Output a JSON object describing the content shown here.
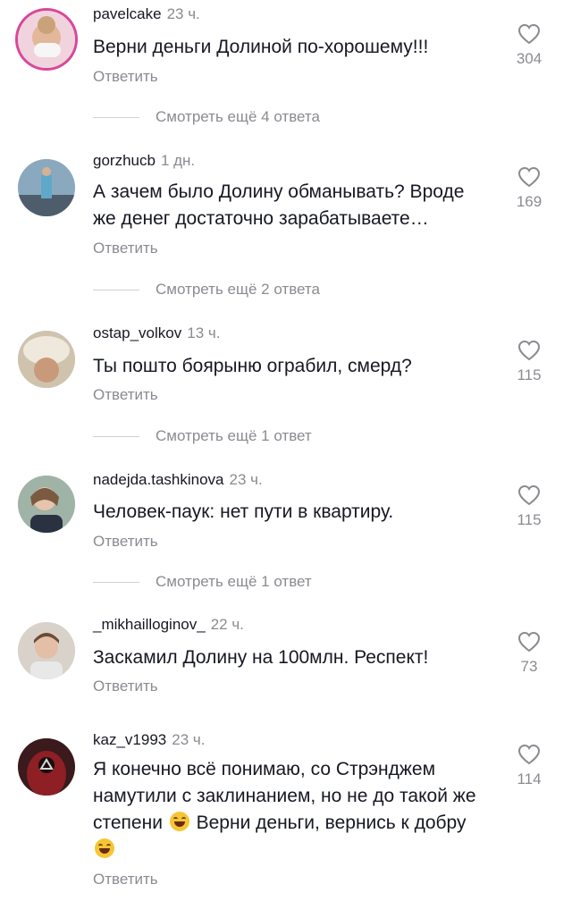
{
  "comments": [
    {
      "username": "pavelcake",
      "time": "23 ч.",
      "text": "Верни деньги Долиной по-хорошему!!!",
      "reply": "Ответить",
      "likes": "304",
      "avatar_color": "#e9b8c8",
      "avatar_ring": "#d9479a"
    },
    {
      "username": "gorzhucb",
      "time": "1 дн.",
      "text": "А зачем было Долину обманывать? Вроде же денег достаточно зарабатываете…",
      "reply": "Ответить",
      "likes": "169",
      "avatar_color": "#6f8fa6"
    },
    {
      "username": "ostap_volkov",
      "time": "13 ч.",
      "text": "Ты пошто боярыню ограбил, смерд?",
      "reply": "Ответить",
      "likes": "115",
      "avatar_color": "#d8c7a8"
    },
    {
      "username": "nadejda.tashkinova",
      "time": "23 ч.",
      "text": "Человек-паук: нет пути в квартиру.",
      "reply": "Ответить",
      "likes": "115",
      "avatar_color": "#b79a86"
    },
    {
      "username": "_mikhailloginov_",
      "time": "22 ч.",
      "text": "Заскамил Долину на 100млн. Респект!",
      "reply": "Ответить",
      "likes": "73",
      "avatar_color": "#c9bfb6"
    },
    {
      "username": "kaz_v1993",
      "time": "23 ч.",
      "text_part1": "Я конечно всё понимаю, со Стрэнджем намутили с заклинанием, но не до такой же степени ",
      "text_part2": " Верни деньги, вернись к добру ",
      "emoji1": "rolling-on-floor-laughing-emoji",
      "emoji2": "tears-of-joy-emoji",
      "reply": "Ответить",
      "likes": "114",
      "avatar_color": "#7a1e22"
    }
  ],
  "view_more": [
    "Смотреть ещё 4 ответа",
    "Смотреть ещё 2 ответа",
    "Смотреть ещё 1 ответ",
    "Смотреть ещё 1 ответ"
  ],
  "icons": {
    "like": "heart-outline-icon"
  }
}
